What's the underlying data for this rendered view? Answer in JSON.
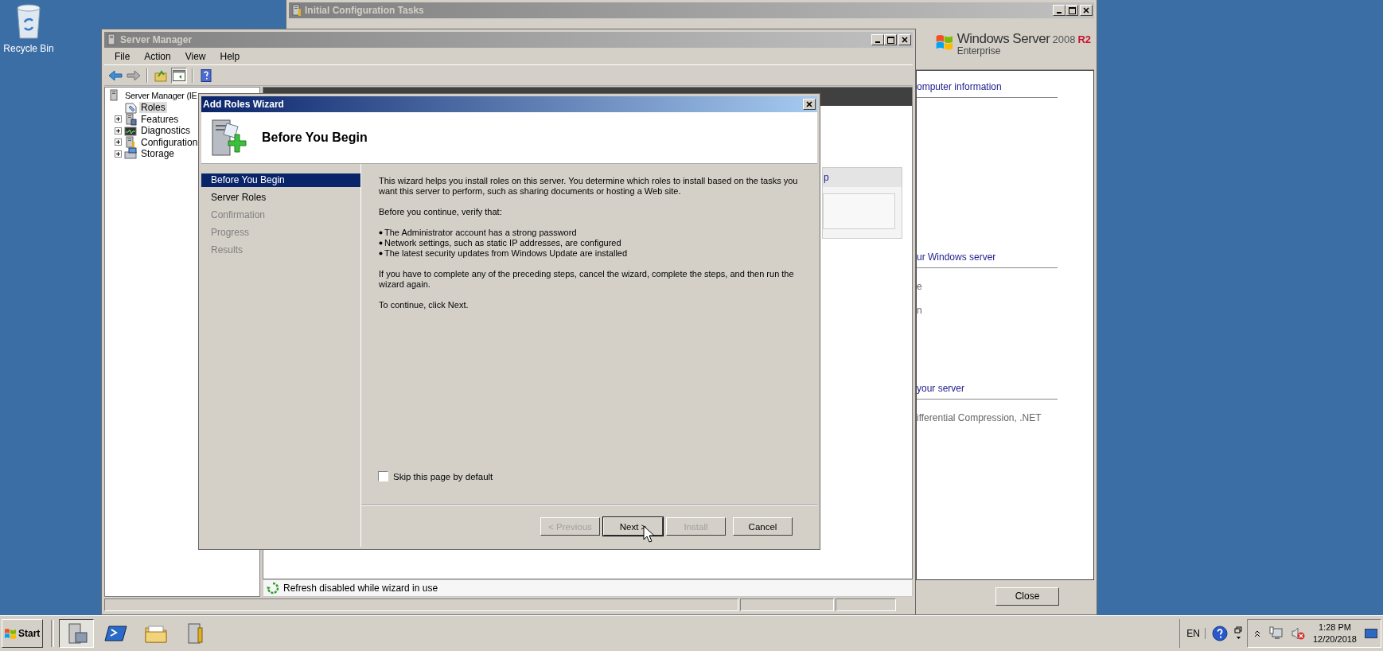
{
  "desktop": {
    "icons": [
      {
        "label": "Recycle Bin"
      }
    ]
  },
  "config_window": {
    "title": "Initial Configuration Tasks",
    "logo": {
      "brand": "Windows Server",
      "version": "2008",
      "release": "R2",
      "edition": "Enterprise"
    },
    "sections": [
      {
        "heading": "omputer information"
      },
      {
        "heading": "ur Windows server",
        "items": [
          "e",
          "n"
        ]
      },
      {
        "heading": "your server",
        "items": [
          "ifferential Compression, .NET"
        ]
      }
    ],
    "close_button": "Close"
  },
  "server_manager": {
    "title": "Server Manager",
    "menu": [
      "File",
      "Action",
      "View",
      "Help"
    ],
    "tree": {
      "label": "Server Manager (IE",
      "children": [
        {
          "label": "Roles",
          "kind": "roles",
          "selected": true,
          "expandable": false
        },
        {
          "label": "Features",
          "kind": "features",
          "selected": false,
          "expandable": true
        },
        {
          "label": "Diagnostics",
          "kind": "diagnostics",
          "selected": false,
          "expandable": true
        },
        {
          "label": "Configuration",
          "kind": "configuration",
          "selected": false,
          "expandable": true
        },
        {
          "label": "Storage",
          "kind": "storage",
          "selected": false,
          "expandable": true
        }
      ]
    },
    "panel_heading": "p",
    "status": "Refresh disabled while wizard in use"
  },
  "wizard": {
    "title": "Add Roles Wizard",
    "heading": "Before You Begin",
    "steps": [
      {
        "label": "Before You Begin",
        "selected": true,
        "disabled": false
      },
      {
        "label": "Server Roles",
        "selected": false,
        "disabled": false
      },
      {
        "label": "Confirmation",
        "selected": false,
        "disabled": true
      },
      {
        "label": "Progress",
        "selected": false,
        "disabled": true
      },
      {
        "label": "Results",
        "selected": false,
        "disabled": true
      }
    ],
    "content": [
      {
        "kind": "paragraph",
        "text": "This wizard helps you install roles on this server. You determine which roles to install based on the tasks you want this server to perform, such as sharing documents or hosting a Web site."
      },
      {
        "kind": "paragraph",
        "text": "Before you continue, verify that:"
      },
      {
        "kind": "bullets",
        "items": [
          "The Administrator account has a strong password",
          "Network settings, such as static IP addresses, are configured",
          "The latest security updates from Windows Update are installed"
        ]
      },
      {
        "kind": "paragraph",
        "text": "If you have to complete any of the preceding steps, cancel the wizard, complete the steps, and then run the wizard again."
      },
      {
        "kind": "paragraph",
        "text": "To continue, click Next."
      }
    ],
    "skip_checkbox": {
      "label": "Skip this page by default",
      "checked": false
    },
    "buttons": [
      {
        "label": "< Previous",
        "disabled": true,
        "default": false
      },
      {
        "label": "Next >",
        "disabled": false,
        "default": true
      },
      {
        "label": "Install",
        "disabled": true,
        "default": false
      },
      {
        "label": "Cancel",
        "disabled": false,
        "default": false
      }
    ]
  },
  "taskbar": {
    "start": "Start",
    "language": "EN",
    "time": "1:28 PM",
    "date": "12/20/2018"
  }
}
